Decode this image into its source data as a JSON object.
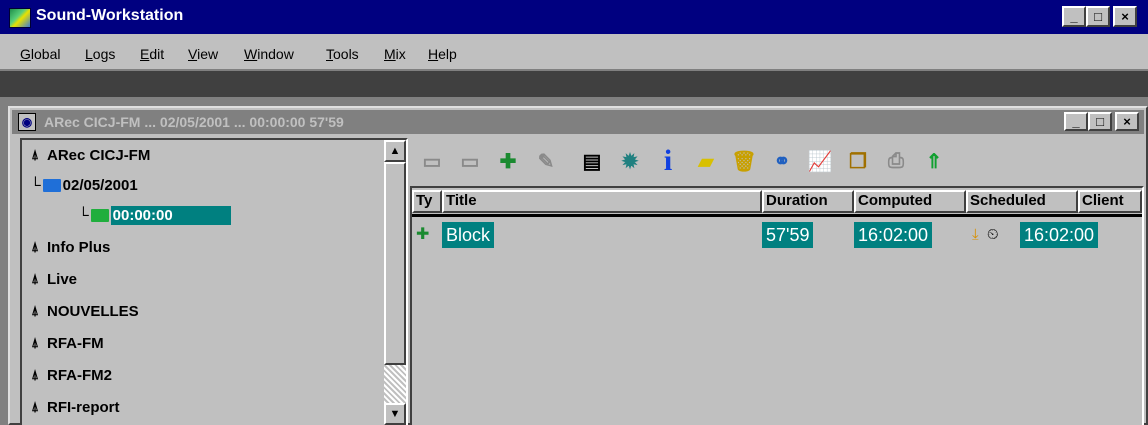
{
  "app": {
    "title": "Sound-Workstation",
    "min_label": "_",
    "max_label": "□",
    "close_label": "×"
  },
  "menu": {
    "items": [
      {
        "label": "Global",
        "underline": "G",
        "rest": "lobal"
      },
      {
        "label": "Logs",
        "underline": "L",
        "rest": "ogs"
      },
      {
        "label": "Edit",
        "underline": "E",
        "rest": "dit"
      },
      {
        "label": "View",
        "underline": "V",
        "rest": "iew"
      },
      {
        "label": "Window",
        "underline": "W",
        "rest": "indow"
      },
      {
        "label": "Tools",
        "underline": "T",
        "rest": "ools"
      },
      {
        "label": "Mix",
        "underline": "M",
        "rest": "ix"
      },
      {
        "label": "Help",
        "underline": "H",
        "rest": "elp"
      }
    ]
  },
  "child_window": {
    "title": "ARec CICJ-FM ... 02/05/2001 ... 00:00:00  57'59"
  },
  "tree": {
    "items": [
      {
        "label": "ARec CICJ-FM",
        "icon": "mast-icon"
      },
      {
        "label": "02/05/2001",
        "icon": "folder-blue-icon"
      },
      {
        "label": "00:00:00",
        "icon": "folder-green-clock-icon",
        "selected": true
      },
      {
        "label": "Info Plus",
        "icon": "mast-icon"
      },
      {
        "label": "Live",
        "icon": "mast-icon"
      },
      {
        "label": "NOUVELLES",
        "icon": "mast-icon"
      },
      {
        "label": "RFA-FM",
        "icon": "mast-icon"
      },
      {
        "label": "RFA-FM2",
        "icon": "mast-icon"
      },
      {
        "label": "RFI-report",
        "icon": "mast-icon"
      }
    ],
    "scroll_up": "▲",
    "scroll_down": "▼"
  },
  "toolbar": {
    "buttons": [
      {
        "icon": "new-block-icon",
        "glyph": "▭",
        "enabled": false
      },
      {
        "icon": "insert-block-icon",
        "glyph": "▭",
        "enabled": false
      },
      {
        "icon": "add-block-icon",
        "glyph": "✚",
        "enabled": true
      },
      {
        "icon": "edit-block-icon",
        "glyph": "✎",
        "enabled": false
      },
      {
        "icon": "properties-icon",
        "glyph": "▤",
        "enabled": true
      },
      {
        "icon": "settings-icon",
        "glyph": "✹",
        "enabled": true
      },
      {
        "icon": "info-icon",
        "glyph": "i",
        "enabled": true
      },
      {
        "icon": "move-icon",
        "glyph": "▰",
        "enabled": true
      },
      {
        "icon": "delete-icon",
        "glyph": "🗑",
        "enabled": true
      },
      {
        "icon": "link-icon",
        "glyph": "⚭",
        "enabled": true
      },
      {
        "icon": "chart-icon",
        "glyph": "📈",
        "enabled": true
      },
      {
        "icon": "copy-icon",
        "glyph": "❐",
        "enabled": true
      },
      {
        "icon": "print-icon",
        "glyph": "⎙",
        "enabled": false
      },
      {
        "icon": "upload-icon",
        "glyph": "⇑",
        "enabled": true
      }
    ]
  },
  "grid": {
    "headers": {
      "type": "Ty",
      "title": "Title",
      "duration": "Duration",
      "computed": "Computed",
      "scheduled": "Scheduled",
      "client": "Client"
    },
    "rows": [
      {
        "type_icon": "block-clock-icon",
        "title": "Block",
        "duration": "57'59",
        "computed": "16:02:00",
        "scheduled": "16:02:00",
        "client": ""
      }
    ]
  },
  "colors": {
    "title_bar_active": "#000080",
    "title_bar_inactive": "#808080",
    "selection": "#008080",
    "face": "#c0c0c0"
  }
}
